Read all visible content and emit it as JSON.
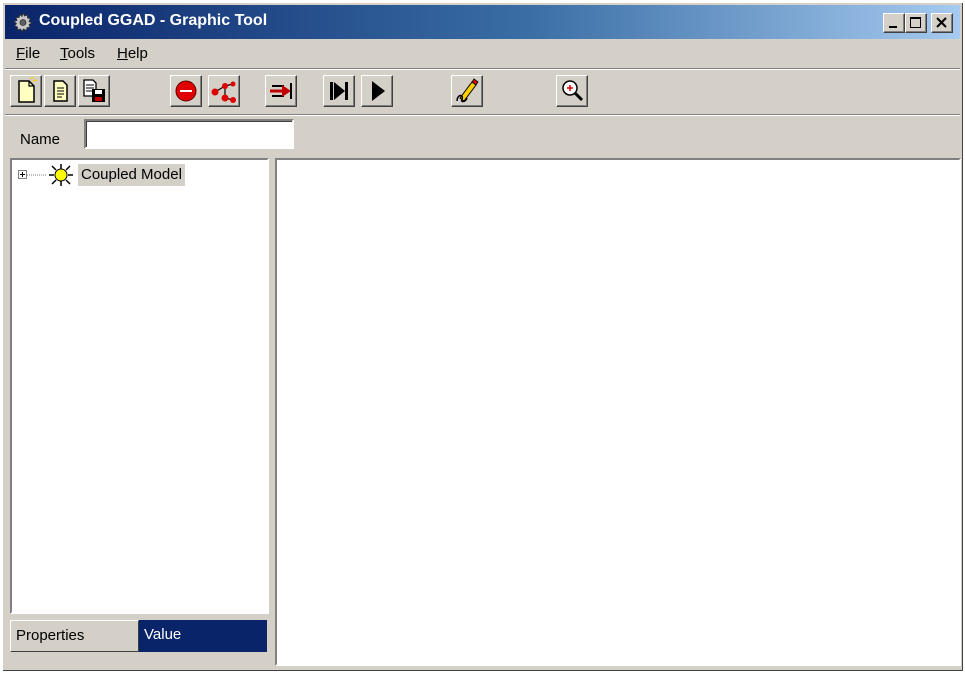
{
  "window": {
    "title": "Coupled GGAD - Graphic Tool",
    "accent": "#0a246a"
  },
  "menu": {
    "file": {
      "accel": "F",
      "rest": "ile"
    },
    "tools": {
      "accel": "T",
      "rest": "ools"
    },
    "help": {
      "accel": "H",
      "rest": "elp"
    }
  },
  "toolbar": {
    "buttons": [
      {
        "icon": "new-document-icon"
      },
      {
        "icon": "open-document-icon"
      },
      {
        "icon": "save-document-icon"
      },
      {
        "icon": "atomic-model-icon"
      },
      {
        "icon": "coupled-link-icon"
      },
      {
        "icon": "input-port-icon"
      },
      {
        "icon": "step-icon"
      },
      {
        "icon": "run-icon"
      },
      {
        "icon": "edit-properties-icon"
      },
      {
        "icon": "zoom-in-icon"
      }
    ]
  },
  "namebar": {
    "label": "Name",
    "value": ""
  },
  "tree": {
    "root_label": "Coupled Model"
  },
  "properties": {
    "col_properties": "Properties",
    "col_value": "Value"
  }
}
